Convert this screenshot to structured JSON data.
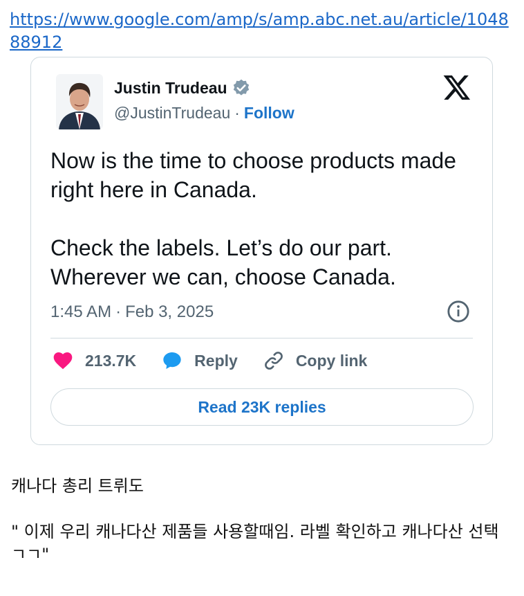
{
  "link": {
    "url": "https://www.google.com/amp/s/amp.abc.net.au/article/104888912"
  },
  "tweet": {
    "author_name": "Justin Trudeau",
    "handle": "@JustinTrudeau",
    "separator": "·",
    "follow_label": "Follow",
    "text_p1": "Now is the time to choose products made right here in Canada.",
    "text_p2": "Check the labels. Let’s do our part. Wherever we can, choose Canada.",
    "time": "1:45 AM",
    "date": "Feb 3, 2025",
    "likes": "213.7K",
    "reply_label": "Reply",
    "copy_link_label": "Copy link",
    "read_replies_label": "Read 23K replies"
  },
  "caption": {
    "line1": "캐나다 총리 트뤼도",
    "line2": "\" 이제 우리 캐나다산 제품들 사용할때임. 라벨 확인하고 캐나다산 선택 ㄱㄱ\""
  },
  "icons": [
    "verified-badge-icon",
    "x-logo-icon",
    "info-icon",
    "heart-icon",
    "reply-bubble-icon",
    "link-icon"
  ],
  "colors": {
    "link_blue": "#1a67c8",
    "follow_blue": "#1d74c9",
    "heart_pink": "#f91880",
    "reply_blue": "#1d9bf0",
    "gray_text": "#536471"
  }
}
